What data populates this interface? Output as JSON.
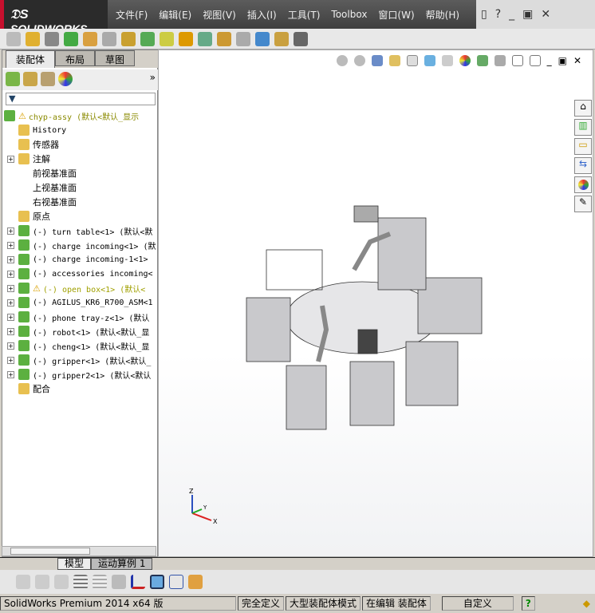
{
  "app": {
    "logo": "SOLIDWORKS",
    "menu": [
      "文件(F)",
      "编辑(E)",
      "视图(V)",
      "插入(I)",
      "工具(T)",
      "Toolbox",
      "窗口(W)",
      "帮助(H)"
    ],
    "help": "?"
  },
  "left_tabs": [
    "装配体",
    "布局",
    "草图"
  ],
  "tree": [
    {
      "label": "chyp-assy  (默认<默认_显示",
      "warn": true,
      "level": 0,
      "expand": false,
      "mono": true,
      "color": "#8a8a00"
    },
    {
      "label": "History",
      "level": 1,
      "mono": true
    },
    {
      "label": "传感器",
      "level": 1
    },
    {
      "label": "注解",
      "level": 1,
      "expand": true
    },
    {
      "label": "前视基准面",
      "level": 1
    },
    {
      "label": "上视基准面",
      "level": 1
    },
    {
      "label": "右视基准面",
      "level": 1
    },
    {
      "label": "原点",
      "level": 1
    },
    {
      "label": "(-) turn table<1> (默认<默",
      "level": 2,
      "expand": true,
      "mono": true
    },
    {
      "label": "(-) charge incoming<1> (默",
      "level": 2,
      "expand": true,
      "mono": true
    },
    {
      "label": "(-) charge incoming-1<1>",
      "level": 2,
      "expand": true,
      "mono": true
    },
    {
      "label": "(-) accessories incoming<",
      "level": 2,
      "expand": true,
      "mono": true
    },
    {
      "label": "(-) open box<1> (默认<",
      "level": 2,
      "expand": true,
      "mono": true,
      "warn": true,
      "color": "#a0a000"
    },
    {
      "label": "(-) AGILUS_KR6_R700_ASM<1",
      "level": 2,
      "expand": true,
      "mono": true
    },
    {
      "label": "(-) phone tray-z<1> (默认",
      "level": 2,
      "expand": true,
      "mono": true
    },
    {
      "label": "(-) robot<1> (默认<默认_显",
      "level": 2,
      "expand": true,
      "mono": true
    },
    {
      "label": "(-) cheng<1> (默认<默认_显",
      "level": 2,
      "expand": true,
      "mono": true
    },
    {
      "label": "(-) gripper<1> (默认<默认_",
      "level": 2,
      "expand": true,
      "mono": true
    },
    {
      "label": "(-) gripper2<1> (默认<默认",
      "level": 2,
      "expand": true,
      "mono": true
    },
    {
      "label": "配合",
      "level": 1
    }
  ],
  "triad": {
    "x": "X",
    "y": "Y",
    "z": "Z"
  },
  "bottom_tabs": [
    "模型",
    "运动算例 1"
  ],
  "status": {
    "product": "SolidWorks Premium 2014 x64 版",
    "defined": "完全定义",
    "mode": "大型装配体模式",
    "editing": "在编辑 装配体",
    "units": "自定义",
    "help": "?"
  }
}
